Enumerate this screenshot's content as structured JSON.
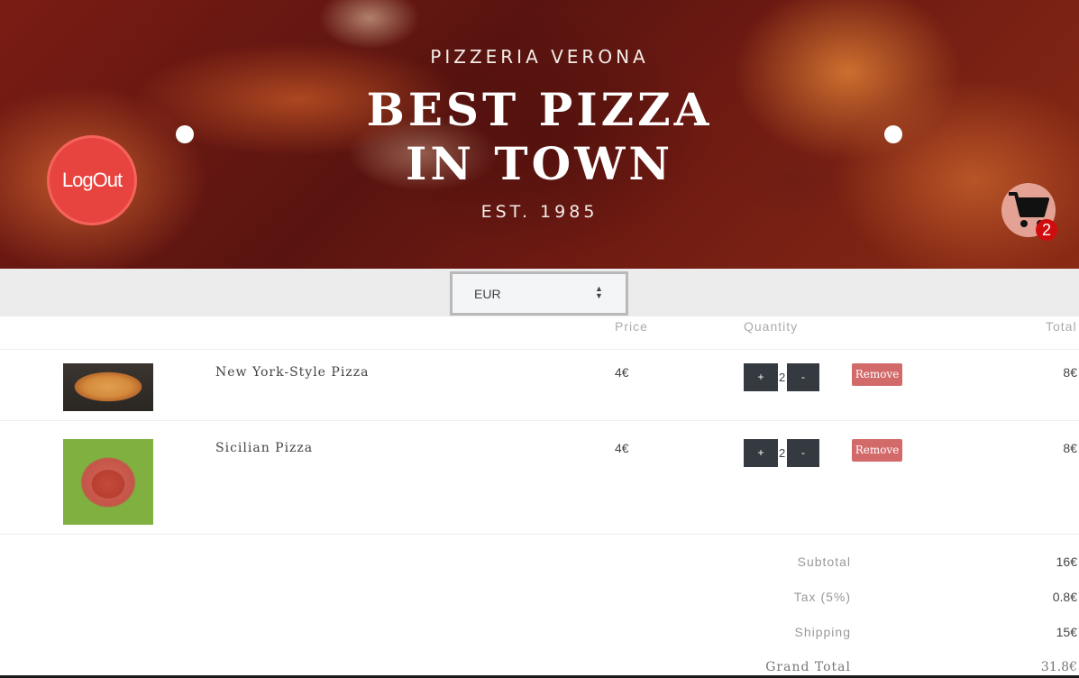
{
  "hero": {
    "subtitle": "PIZZERIA VERONA",
    "title_line1": "BEST PIZZA",
    "title_line2": "IN TOWN",
    "est": "EST. 1985"
  },
  "header": {
    "logout_label": "LogOut",
    "cart_count": "2"
  },
  "currency": {
    "selected": "EUR"
  },
  "table": {
    "headers": {
      "price": "Price",
      "quantity": "Quantity",
      "total": "Total"
    },
    "rows": [
      {
        "name": "New York-Style Pizza",
        "price": "4€",
        "quantity": "2",
        "plus": "+",
        "minus": "-",
        "remove": "Remove",
        "total": "8€"
      },
      {
        "name": "Sicilian Pizza",
        "price": "4€",
        "quantity": "2",
        "plus": "+",
        "minus": "-",
        "remove": "Remove",
        "total": "8€"
      }
    ]
  },
  "summary": {
    "subtotal_label": "Subtotal",
    "subtotal": "16€",
    "tax_label": "Tax (5%)",
    "tax": "0.8€",
    "shipping_label": "Shipping",
    "shipping": "15€",
    "grand_total_label": "Grand Total",
    "grand_total": "31.8€"
  },
  "colors": {
    "logout": "#e8443f",
    "qty_button": "#343a40",
    "remove_button": "#d36a6a",
    "cart_badge": "#d00d0d"
  }
}
